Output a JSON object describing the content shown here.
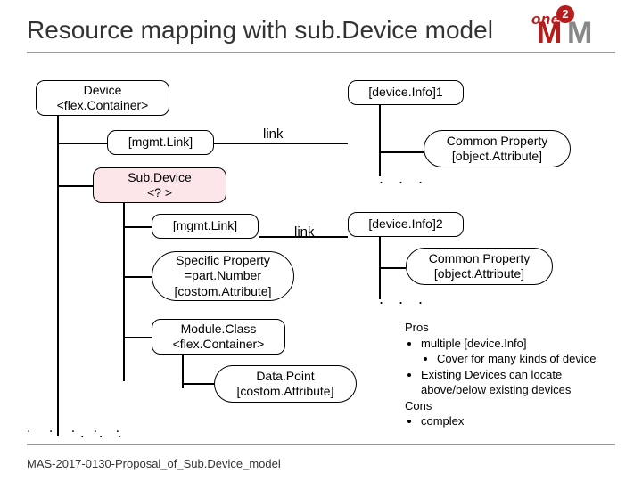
{
  "title": "Resource mapping with sub.Device model",
  "logo": {
    "one": "one",
    "m1": "M",
    "m2": "M",
    "circle": "2"
  },
  "nodes": {
    "device": {
      "line1": "Device",
      "line2": "<flex.Container>"
    },
    "mgmt1": "[mgmt.Link]",
    "subdevice": {
      "line1": "Sub.Device",
      "line2": "<? >"
    },
    "mgmt2": "[mgmt.Link]",
    "specific": {
      "line1": "Specific Property",
      "line2": "=part.Number",
      "line3": "[costom.Attribute]"
    },
    "moduleclass": {
      "line1": "Module.Class",
      "line2": "<flex.Container>"
    },
    "datapoint": {
      "line1": "Data.Point",
      "line2": "[costom.Attribute]"
    },
    "devinfo1": "[device.Info]1",
    "devinfo2": "[device.Info]2",
    "common1": {
      "line1": "Common Property",
      "line2": "[object.Attribute]"
    },
    "common2": {
      "line1": "Common Property",
      "line2": "[object.Attribute]"
    }
  },
  "labels": {
    "link1": "link",
    "link2": "link"
  },
  "pros": {
    "prosHdr": "Pros",
    "p1": "multiple [device.Info]",
    "p1a": "Cover for many kinds of device",
    "p2": "Existing Devices can locate above/below existing devices",
    "consHdr": "Cons",
    "c1": "complex"
  },
  "footer": "MAS-2017-0130-Proposal_of_Sub.Device_model",
  "dots": ". . .",
  "dotsRow": ". . . . ."
}
